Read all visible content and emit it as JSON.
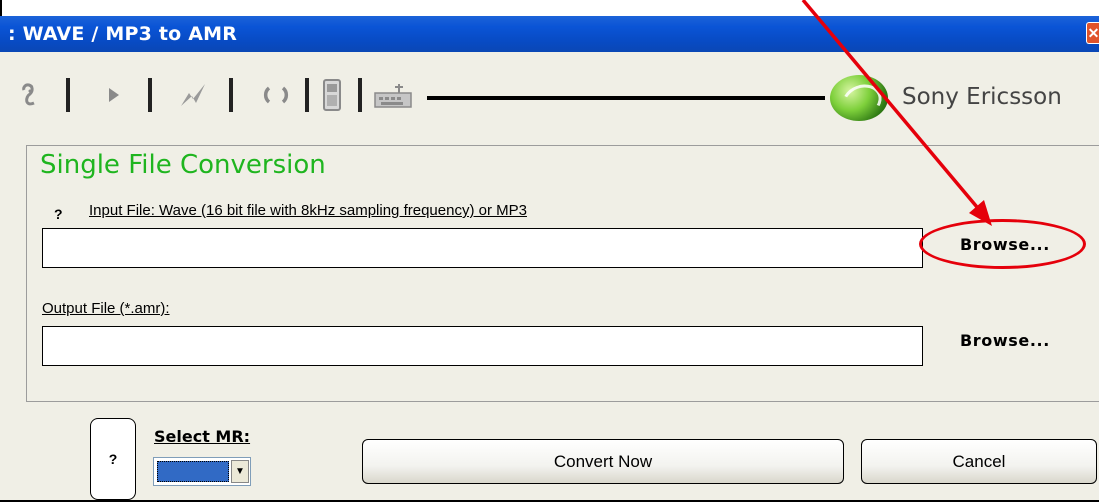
{
  "window": {
    "title": ": WAVE / MP3 to AMR",
    "close_glyph": "✕"
  },
  "toolbar": {
    "icons": [
      "ear-icon",
      "play-icon",
      "signal-icon",
      "refresh-icon",
      "phone-icon",
      "keyboard-icon"
    ],
    "brand": "Sony Ericsson"
  },
  "panel": {
    "title": "Single File Conversion",
    "help_mark": "?",
    "input_label": "Input File: Wave (16 bit  file with 8kHz sampling frequency) or MP3",
    "input_value": "",
    "input_browse": "Browse...",
    "output_label": "Output File (*.amr):",
    "output_value": "",
    "output_browse": "Browse..."
  },
  "bottom": {
    "help_mark": "?",
    "mr_label": "Select MR:",
    "mr_arrow": "▼",
    "convert_label": "Convert Now",
    "cancel_label": "Cancel"
  },
  "annotation": {
    "color": "#e5000b"
  }
}
